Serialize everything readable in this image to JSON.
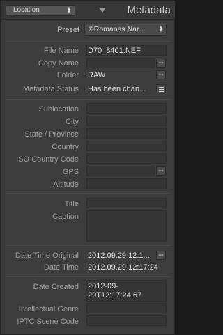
{
  "header": {
    "view_select": "Location",
    "title": "Metadata"
  },
  "preset": {
    "label": "Preset",
    "value": "©Romanas Nar..."
  },
  "file_info": [
    {
      "label": "File Name",
      "value": "D70_8401.NEF"
    },
    {
      "label": "Copy Name",
      "value": ""
    },
    {
      "label": "Folder",
      "value": "RAW"
    },
    {
      "label": "Metadata Status",
      "value": "Has been chan..."
    }
  ],
  "location": [
    {
      "label": "Sublocation",
      "value": ""
    },
    {
      "label": "City",
      "value": ""
    },
    {
      "label": "State / Province",
      "value": ""
    },
    {
      "label": "Country",
      "value": ""
    },
    {
      "label": "ISO Country Code",
      "value": ""
    },
    {
      "label": "GPS",
      "value": ""
    },
    {
      "label": "Altitude",
      "value": ""
    }
  ],
  "caption": [
    {
      "label": "Title",
      "value": ""
    },
    {
      "label": "Caption",
      "value": ""
    }
  ],
  "dates": [
    {
      "label": "Date Time Original",
      "value": "2012.09.29 12:1..."
    },
    {
      "label": "Date Time",
      "value": "2012.09.29 12:17:24"
    }
  ],
  "iptc": [
    {
      "label": "Date Created",
      "value_line1": "2012-09-",
      "value_line2": "29T12:17:24.67"
    },
    {
      "label": "Intellectual Genre",
      "value": ""
    },
    {
      "label": "IPTC Scene Code",
      "value": ""
    }
  ],
  "icons": {
    "jump": "right-arrow-icon",
    "list": "list-icon",
    "updown": "up-down-arrows-icon",
    "collapse": "triangle-down-icon"
  }
}
